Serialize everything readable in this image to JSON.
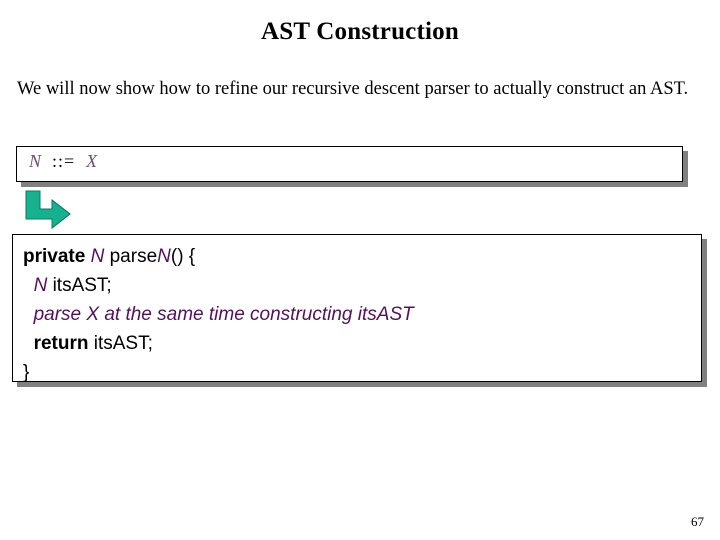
{
  "slide": {
    "title": "AST Construction",
    "page_number": "67",
    "body_text": "We will now show how to refine our recursive descent parser to actually construct an AST."
  },
  "rule_box": {
    "nonterminal": "N",
    "operator": "::=",
    "right_hand_side": "X",
    "full_text": "N ::= X"
  },
  "arrow": {
    "icon": "elbow-arrow-down-right-icon",
    "color": "#18b190"
  },
  "code_box": {
    "full_text": "private N parseN() {\n  N itsAST;\n  parse X at the same time constructing itsAST\n  return itsAST;\n}",
    "lines": [
      {
        "segments": [
          {
            "text": "private ",
            "style": "kw"
          },
          {
            "text": "N",
            "style": "meta-ital"
          },
          {
            "text": " parse",
            "style": "plain"
          },
          {
            "text": "N",
            "style": "meta-ital"
          },
          {
            "text": "() {",
            "style": "plain"
          }
        ]
      },
      {
        "segments": [
          {
            "text": "  ",
            "style": "plain"
          },
          {
            "text": "N",
            "style": "meta-ital"
          },
          {
            "text": " itsAST;",
            "style": "plain"
          }
        ]
      },
      {
        "segments": [
          {
            "text": "  ",
            "style": "plain"
          },
          {
            "text": "parse X at the same time constructing itsAST",
            "style": "meta-ital"
          }
        ]
      },
      {
        "segments": [
          {
            "text": "  ",
            "style": "plain"
          },
          {
            "text": "return",
            "style": "kw"
          },
          {
            "text": " itsAST;",
            "style": "plain"
          }
        ]
      },
      {
        "segments": [
          {
            "text": "}",
            "style": "plain"
          }
        ]
      }
    ]
  },
  "colors": {
    "nonterminal_purple": "#54105c",
    "rule_italic_purple": "#6b4f72",
    "arrow_green": "#18b190",
    "shadow_gray": "#808080",
    "text_black": "#000000",
    "background": "#ffffff"
  }
}
